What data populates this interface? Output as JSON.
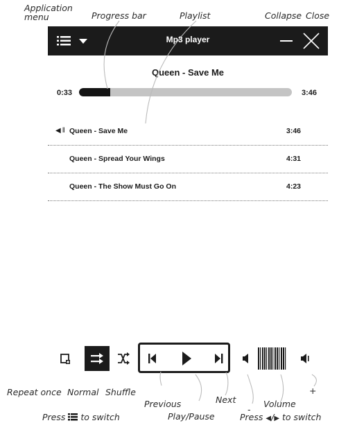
{
  "callouts": {
    "app_menu": "Application\nmenu",
    "progress": "Progress bar",
    "playlist": "Playlist",
    "collapse": "Collapse",
    "close": "Close",
    "repeat_once": "Repeat once",
    "normal": "Normal",
    "shuffle": "Shuffle",
    "previous": "Previous",
    "play_pause": "Play/Pause",
    "next": "Next",
    "volume": "Volume",
    "volume_minus": "-",
    "volume_plus": "+",
    "press_mode_prefix": "Press",
    "press_mode_suffix": "to switch",
    "press_vol_prefix": "Press",
    "press_vol_sep": "/",
    "press_vol_suffix": "to switch"
  },
  "header": {
    "title": "Mp3 player"
  },
  "now_playing": {
    "title": "Queen - Save Me",
    "elapsed": "0:33",
    "total": "3:46",
    "progress_fraction": 0.146
  },
  "playlist": [
    {
      "name": "Queen - Save Me",
      "duration": "3:46",
      "playing": true
    },
    {
      "name": "Queen - Spread Your Wings",
      "duration": "4:31",
      "playing": false
    },
    {
      "name": "Queen - The Show Must Go On",
      "duration": "4:23",
      "playing": false
    }
  ],
  "controls": {
    "active_mode": "normal"
  },
  "icons": {
    "menu": "hamburger-menu-icon",
    "dropdown": "triangle-down-icon",
    "collapse": "minus-icon",
    "close": "x-icon",
    "speaker": "speaker-icon",
    "repeat_once": "repeat-once-icon",
    "normal": "normal-order-icon",
    "shuffle": "shuffle-icon",
    "previous": "skip-previous-icon",
    "play": "play-icon",
    "next": "skip-next-icon",
    "volume_down": "volume-down-icon",
    "volume_up": "volume-up-icon",
    "volume_level": "volume-level-bars"
  },
  "colors": {
    "bar_bg": "#1b1b1b",
    "track": "#c4c4c4",
    "fill": "#141414"
  }
}
